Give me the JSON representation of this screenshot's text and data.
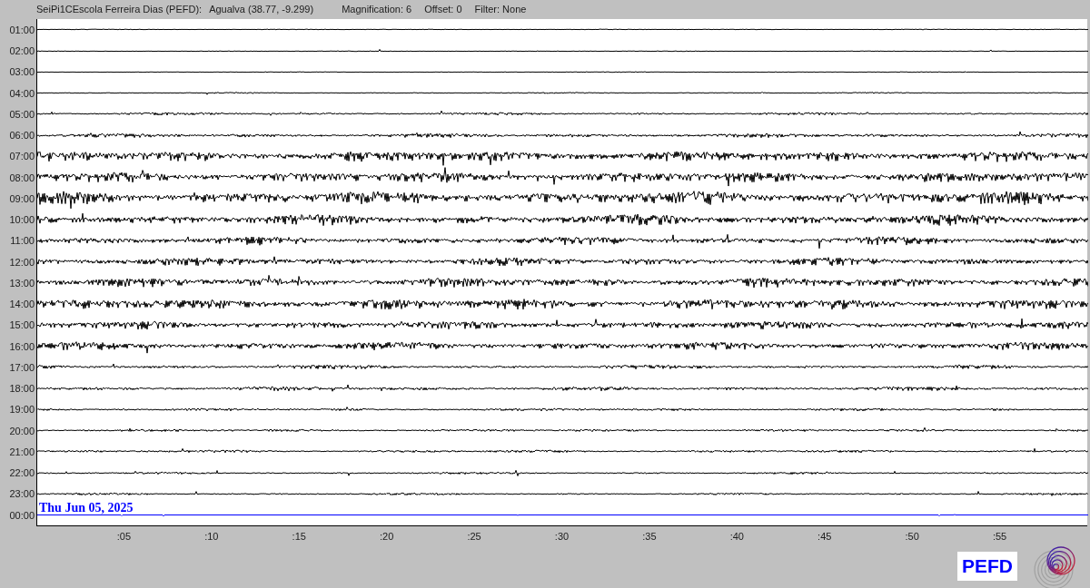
{
  "header": {
    "station": "SeiPi1CEscola Ferreira Dias (PEFD):",
    "location": "Agualva (38.77, -9.299)",
    "magnification": "Magnification: 6",
    "offset": "Offset: 0",
    "filter": "Filter: None"
  },
  "rows": [
    {
      "time": "01:00",
      "color": "#000000"
    },
    {
      "time": "02:00",
      "color": "#000000"
    },
    {
      "time": "03:00",
      "color": "#000000"
    },
    {
      "time": "04:00",
      "color": "#000000"
    },
    {
      "time": "05:00",
      "color": "#000000"
    },
    {
      "time": "06:00",
      "color": "#000000"
    },
    {
      "time": "07:00",
      "color": "#000000"
    },
    {
      "time": "08:00",
      "color": "#000000"
    },
    {
      "time": "09:00",
      "color": "#000000"
    },
    {
      "time": "10:00",
      "color": "#000000"
    },
    {
      "time": "11:00",
      "color": "#000000"
    },
    {
      "time": "12:00",
      "color": "#000000"
    },
    {
      "time": "13:00",
      "color": "#000000"
    },
    {
      "time": "14:00",
      "color": "#000000"
    },
    {
      "time": "15:00",
      "color": "#000000"
    },
    {
      "time": "16:00",
      "color": "#000000"
    },
    {
      "time": "17:00",
      "color": "#000000"
    },
    {
      "time": "18:00",
      "color": "#000000"
    },
    {
      "time": "19:00",
      "color": "#000000"
    },
    {
      "time": "20:00",
      "color": "#000000"
    },
    {
      "time": "21:00",
      "color": "#000000"
    },
    {
      "time": "22:00",
      "color": "#000000"
    },
    {
      "time": "23:00",
      "color": "#000000"
    },
    {
      "time": "00:00",
      "color": "#0000ff"
    }
  ],
  "date_label": "Thu Jun 05, 2025",
  "x_ticks": [
    ":05",
    ":10",
    ":15",
    ":20",
    ":25",
    ":30",
    ":35",
    ":40",
    ":45",
    ":50",
    ":55"
  ],
  "station_badge": "PEFD"
}
